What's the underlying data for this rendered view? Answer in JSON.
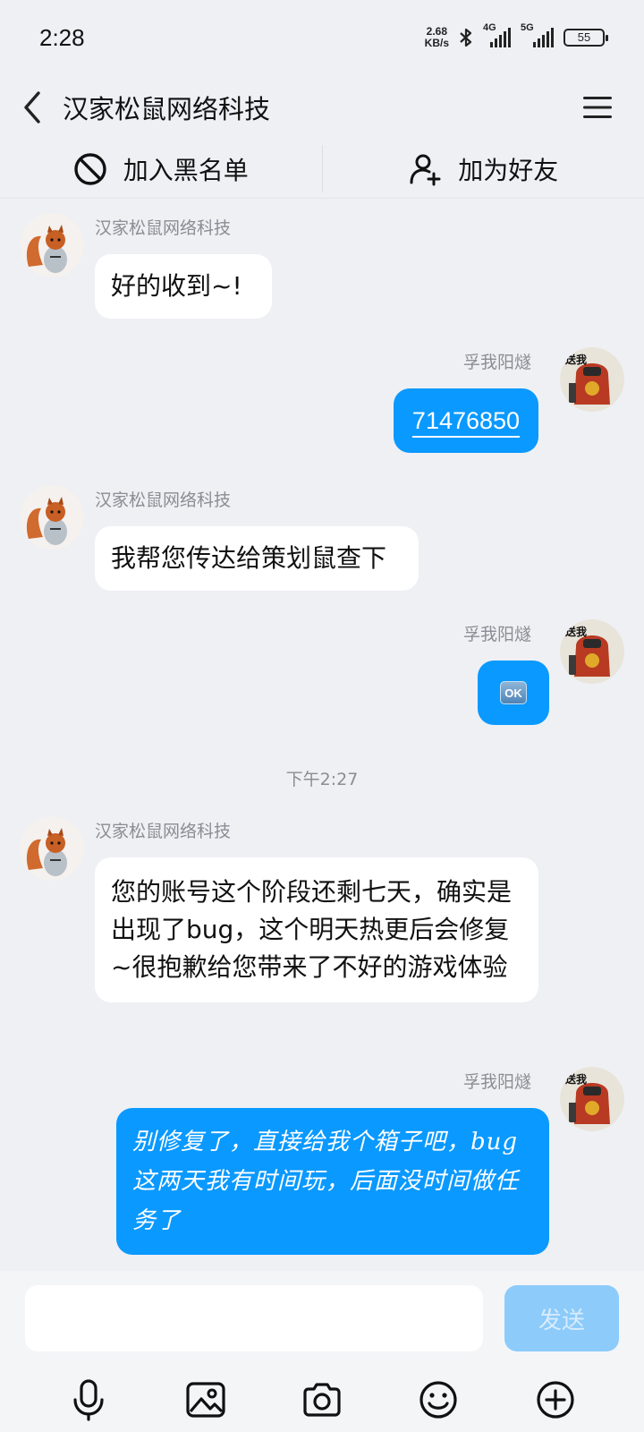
{
  "status_bar": {
    "time": "2:28",
    "net_speed_value": "2.68",
    "net_speed_unit": "KB/s",
    "signal1_label": "4G",
    "signal2_label": "5G",
    "battery": "55"
  },
  "header": {
    "title": "汉家松鼠网络科技"
  },
  "actions": {
    "blacklist_label": "加入黑名单",
    "add_friend_label": "加为好友"
  },
  "messages": [
    {
      "sender": "汉家松鼠网络科技",
      "text": "好的收到~!"
    },
    {
      "sender": "孚我阳燧",
      "text": "71476850"
    },
    {
      "sender": "汉家松鼠网络科技",
      "text": "我帮您传达给策划鼠查下"
    },
    {
      "sender": "孚我阳燧",
      "text": "OK"
    },
    {
      "sender": "汉家松鼠网络科技",
      "text": "您的账号这个阶段还剩七天，确实是出现了bug，这个明天热更后会修复~很抱歉给您带来了不好的游戏体验"
    },
    {
      "sender": "孚我阳燧",
      "text": "别修复了，直接给我个箱子吧，bug这两天我有时间玩，后面没时间做任务了"
    }
  ],
  "timestamp": "下午2:27",
  "composer": {
    "send_label": "发送"
  },
  "avatar_text": "送我"
}
